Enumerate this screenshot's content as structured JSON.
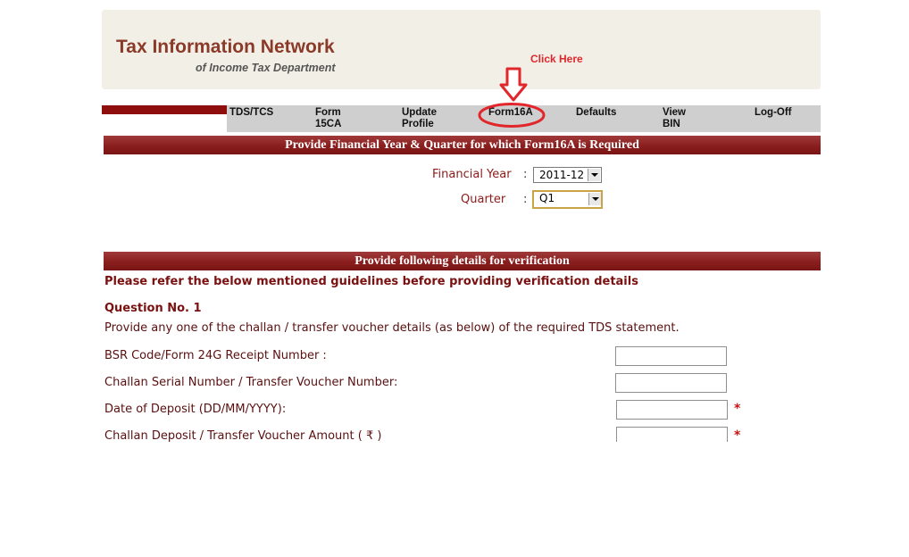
{
  "header": {
    "title": "Tax Information Network",
    "subtitle": "of Income Tax Department"
  },
  "annotation": {
    "click_here": "Click Here"
  },
  "nav": {
    "items": [
      "TDS/TCS",
      "Form\n15CA",
      "Update\nProfile",
      "Form16A",
      "Defaults",
      "View\nBIN",
      "Log-Off"
    ]
  },
  "section1": {
    "banner": "Provide Financial Year & Quarter for which Form16A is Required",
    "financial_year_label": "Financial Year",
    "financial_year_value": "2011-12",
    "quarter_label": "Quarter",
    "quarter_value": "Q1",
    "colon": ":"
  },
  "section2": {
    "banner": "Provide following details for verification",
    "guidelines": "Please refer the below mentioned guidelines before providing verification details",
    "question": "Question No. 1",
    "instruction": "Provide any one of the challan / transfer voucher details (as below) of the required TDS statement.",
    "fields": [
      {
        "label": "BSR Code/Form 24G Receipt Number :",
        "value": "",
        "required": ""
      },
      {
        "label": "Challan Serial Number / Transfer Voucher Number:",
        "value": "",
        "required": ""
      },
      {
        "label": "Date of Deposit (DD/MM/YYYY):",
        "value": "",
        "required": "*"
      },
      {
        "label": "Challan Deposit / Transfer Voucher Amount ( ₹ )",
        "value": "",
        "required": "*"
      }
    ]
  },
  "colors": {
    "brand_maroon": "#8e0e0e",
    "title_brown": "#8b3a2a",
    "annotation_red": "#e1262c",
    "nav_gray": "#cfcfcf",
    "header_bg": "#f2f0e6"
  }
}
